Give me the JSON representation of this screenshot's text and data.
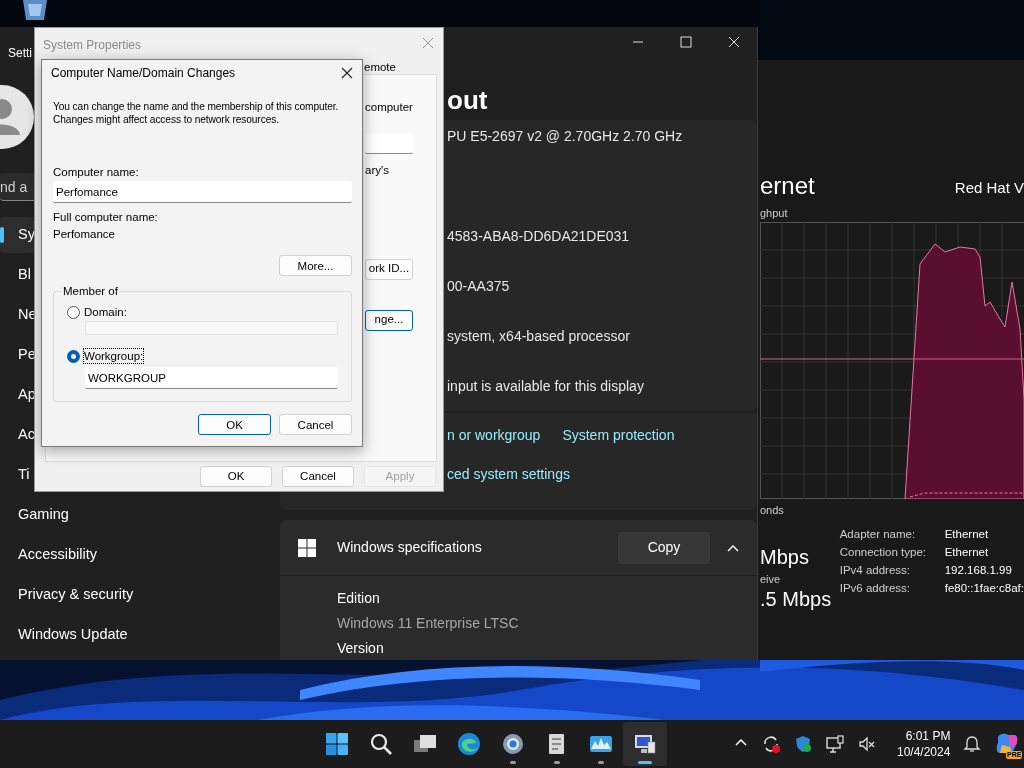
{
  "settings": {
    "title": "Setti",
    "search_placeholder": "nd a",
    "nav": [
      {
        "label": "Sy",
        "selected": true
      },
      {
        "label": "Bl",
        "selected": false
      },
      {
        "label": "Ne",
        "selected": false
      },
      {
        "label": "Pe",
        "selected": false
      },
      {
        "label": "Ap",
        "selected": false
      },
      {
        "label": "Ac",
        "selected": false
      },
      {
        "label": "Ti",
        "selected": false
      },
      {
        "label": "Gaming",
        "selected": false
      },
      {
        "label": "Accessibility",
        "selected": false
      },
      {
        "label": "Privacy & security",
        "selected": false
      },
      {
        "label": "Windows Update",
        "selected": false
      }
    ],
    "heading": "out",
    "device_specs": [
      "PU E5-2697 v2 @ 2.70GHz   2.70 GHz",
      "4583-ABA8-DD6DA21DE031",
      "00-AA375",
      "system, x64-based processor",
      "input is available for this display"
    ],
    "links": [
      "n or workgroup",
      "System protection"
    ],
    "advanced_link": "ced system settings",
    "windows_specs": {
      "title": "Windows specifications",
      "copy_label": "Copy",
      "expanded": true,
      "fields": [
        {
          "label": "Edition",
          "value": "Windows 11 Enterprise LTSC"
        },
        {
          "label": "Version"
        }
      ]
    }
  },
  "task_manager": {
    "title": "ernet",
    "adapter": "Red Hat V",
    "graph_label": "ghput",
    "time_label": "onds",
    "send_speed": "Mbps",
    "receive_label": "eive",
    "receive_speed": ".5 Mbps",
    "details": [
      {
        "label": "Adapter name:",
        "value": "Ethernet"
      },
      {
        "label": "Connection type:",
        "value": "Ethernet"
      },
      {
        "label": "IPv4 address:",
        "value": "192.168.1.99"
      },
      {
        "label": "IPv6 address:",
        "value": "fe80::1fae:c8af:"
      }
    ]
  },
  "system_properties": {
    "title": "System Properties",
    "active": false,
    "tab": "emote",
    "text_1": "computer",
    "text_2": "ary's",
    "network_id_button": "ork ID...",
    "change_button": {
      "label": "nge...",
      "default": true
    },
    "buttons": [
      {
        "label": "OK",
        "disabled": false
      },
      {
        "label": "Cancel",
        "disabled": false
      },
      {
        "label": "Apply",
        "disabled": true
      }
    ]
  },
  "dialog": {
    "title": "Computer Name/Domain Changes",
    "description": "You can change the name and the membership of this computer. Changes might affect access to network resources.",
    "computer_name_label": "Computer name:",
    "computer_name": "Perfomance",
    "full_name_label": "Full computer name:",
    "full_name": "Perfomance",
    "more_button": "More...",
    "member_of": "Member of",
    "options": [
      {
        "label": "Domain:",
        "selected": false,
        "focused": false
      },
      {
        "label": "Workgroup:",
        "selected": true,
        "focused": true,
        "value": "WORKGROUP"
      }
    ],
    "buttons": [
      {
        "label": "OK",
        "default": true
      },
      {
        "label": "Cancel",
        "default": false
      }
    ]
  },
  "taskbar": {
    "apps": [
      {
        "kind": "start",
        "running": false,
        "active": false
      },
      {
        "kind": "search",
        "running": false,
        "active": false
      },
      {
        "kind": "taskview",
        "running": false,
        "active": false
      },
      {
        "kind": "edge",
        "running": false,
        "active": false
      },
      {
        "kind": "settings",
        "running": true,
        "active": false
      },
      {
        "kind": "notepad",
        "running": true,
        "active": false
      },
      {
        "kind": "taskmanager",
        "running": true,
        "active": false
      },
      {
        "kind": "system",
        "running": true,
        "active": true
      }
    ],
    "tray": [
      {
        "kind": "chevron"
      },
      {
        "kind": "sync"
      },
      {
        "kind": "shield"
      },
      {
        "kind": "network"
      },
      {
        "kind": "muted"
      }
    ],
    "time": "6:01 PM",
    "date": "10/4/2024",
    "copilot_badge": "PRE"
  }
}
